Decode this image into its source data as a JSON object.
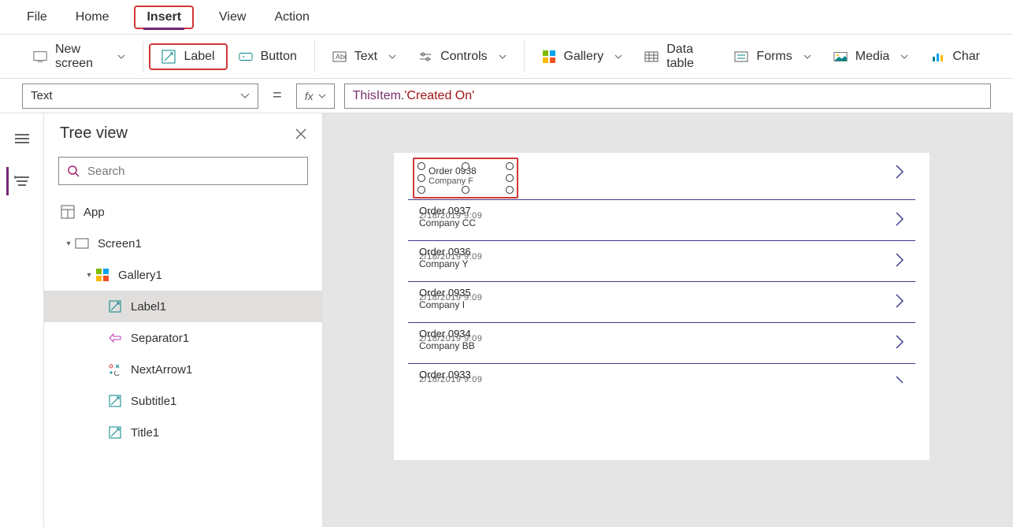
{
  "menu": {
    "file": "File",
    "home": "Home",
    "insert": "Insert",
    "view": "View",
    "action": "Action"
  },
  "ribbon": {
    "new_screen": "New screen",
    "label": "Label",
    "button": "Button",
    "text": "Text",
    "controls": "Controls",
    "gallery": "Gallery",
    "data_table": "Data table",
    "forms": "Forms",
    "media": "Media",
    "charts": "Char"
  },
  "formula": {
    "property": "Text",
    "fx": "fx",
    "token_this": "ThisItem",
    "token_dot": ".",
    "token_field": "'Created On'"
  },
  "tree": {
    "title": "Tree view",
    "search_placeholder": "Search",
    "app": "App",
    "screen1": "Screen1",
    "gallery1": "Gallery1",
    "label1": "Label1",
    "separator1": "Separator1",
    "nextarrow1": "NextArrow1",
    "subtitle1": "Subtitle1",
    "title1": "Title1"
  },
  "gallery_items": [
    {
      "title": "Order 0938",
      "subtitle": "Company F",
      "overlaid": ""
    },
    {
      "title": "Order 0937",
      "subtitle": "Company CC",
      "overlaid": "2/18/2019 9:09"
    },
    {
      "title": "Order 0936",
      "subtitle": "Company Y",
      "overlaid": "2/18/2019 9:09"
    },
    {
      "title": "Order 0935",
      "subtitle": "Company I",
      "overlaid": "2/18/2019 9:09"
    },
    {
      "title": "Order 0934",
      "subtitle": "Company BB",
      "overlaid": "2/18/2019 9:09"
    },
    {
      "title": "Order 0933",
      "subtitle": "",
      "overlaid": "2/18/2019 9:09"
    }
  ]
}
